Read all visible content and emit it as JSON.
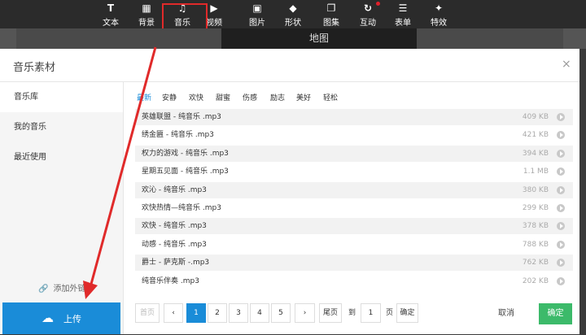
{
  "toolbar": {
    "tools": [
      {
        "label": "文本",
        "icon": "T",
        "icon_name": "text-icon"
      },
      {
        "label": "背景",
        "icon": "▦",
        "icon_name": "grid-icon"
      },
      {
        "label": "音乐",
        "icon": "♫",
        "icon_name": "music-icon"
      },
      {
        "label": "视频",
        "icon": "▶",
        "icon_name": "video-icon"
      },
      {
        "label": "图片",
        "icon": "▣",
        "icon_name": "image-icon"
      },
      {
        "label": "形状",
        "icon": "◆",
        "icon_name": "shape-icon"
      },
      {
        "label": "图集",
        "icon": "❐",
        "icon_name": "gallery-icon"
      },
      {
        "label": "互动",
        "icon": "↻",
        "icon_name": "refresh-icon"
      },
      {
        "label": "表单",
        "icon": "☰",
        "icon_name": "list-icon"
      },
      {
        "label": "特效",
        "icon": "✦",
        "icon_name": "effects-icon"
      }
    ]
  },
  "canvas": {
    "map_label": "地图"
  },
  "dialog": {
    "title": "音乐素材",
    "close_icon": "×",
    "sidebar": {
      "items": [
        {
          "label": "音乐库",
          "active": true
        },
        {
          "label": "我的音乐",
          "active": false
        },
        {
          "label": "最近使用",
          "active": false
        }
      ],
      "ext_link_icon": "🔗",
      "ext_link_label": "添加外链",
      "upload_icon": "☁",
      "upload_label": "上传"
    },
    "categories": [
      "最新",
      "安静",
      "欢快",
      "甜蜜",
      "伤感",
      "励志",
      "美好",
      "轻松"
    ],
    "active_category": "最新",
    "tracks": [
      {
        "name": "英雄联盟 - 纯音乐 .mp3",
        "size": "409 KB"
      },
      {
        "name": "绣金匾 - 纯音乐 .mp3",
        "size": "421 KB"
      },
      {
        "name": "权力的游戏 - 纯音乐 .mp3",
        "size": "394 KB"
      },
      {
        "name": "星期五见面 - 纯音乐 .mp3",
        "size": "1.1 MB"
      },
      {
        "name": "欢沁 - 纯音乐 .mp3",
        "size": "380 KB"
      },
      {
        "name": "欢快热情—纯音乐 .mp3",
        "size": "299 KB"
      },
      {
        "name": "欢快 - 纯音乐 .mp3",
        "size": "378 KB"
      },
      {
        "name": "动感 - 纯音乐 .mp3",
        "size": "788 KB"
      },
      {
        "name": "爵士 - 萨克斯 -.mp3",
        "size": "762 KB"
      },
      {
        "name": "纯音乐伴奏 .mp3",
        "size": "202 KB"
      }
    ],
    "pager": {
      "first": "首页",
      "prev": "‹",
      "pages": [
        "1",
        "2",
        "3",
        "4",
        "5"
      ],
      "current": "1",
      "next": "›",
      "last": "尾页",
      "goto_prefix": "到",
      "goto_value": "1",
      "goto_suffix": "页",
      "confirm": "确定"
    },
    "cancel_label": "取消",
    "ok_label": "确定"
  },
  "colors": {
    "accent": "#1a8cd8",
    "ok": "#3cba6a",
    "highlight": "#e02a2a"
  }
}
